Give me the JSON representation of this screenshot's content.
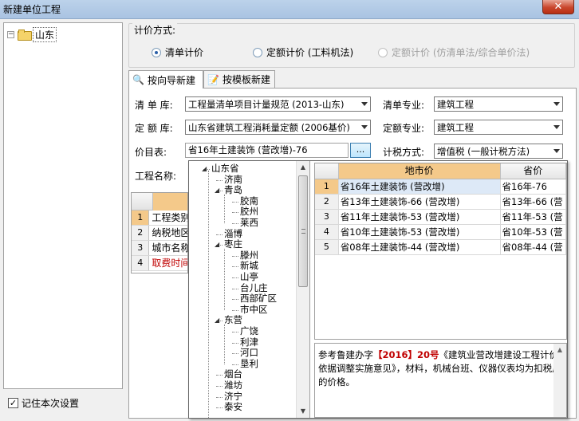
{
  "window": {
    "title": "新建单位工程",
    "close_glyph": "✕"
  },
  "region_tree": {
    "root": "山东",
    "expander": "−"
  },
  "pricing": {
    "legend": "计价方式:",
    "options": [
      {
        "label": "清单计价",
        "selected": true,
        "enabled": true
      },
      {
        "label": "定额计价 (工料机法)",
        "selected": false,
        "enabled": true
      },
      {
        "label": "定额计价 (仿清单法/综合单价法)",
        "selected": false,
        "enabled": false
      }
    ]
  },
  "tabs": [
    {
      "label": "按向导新建",
      "icon": "magnifier-icon",
      "active": true
    },
    {
      "label": "按模板新建",
      "icon": "template-icon",
      "active": false
    }
  ],
  "form": {
    "list_lib_label": "清 单 库:",
    "list_lib_value": "工程量清单项目计量规范 (2013-山东)",
    "list_spec_label": "清单专业:",
    "list_spec_value": "建筑工程",
    "quota_lib_label": "定 额 库:",
    "quota_lib_value": "山东省建筑工程消耗量定额 (2006基价)",
    "quota_spec_label": "定额专业:",
    "quota_spec_value": "建筑工程",
    "price_table_label": "价目表:",
    "price_table_value": "省16年土建装饰 (营改增)-76",
    "browse_label": "...",
    "tax_label": "计税方式:",
    "tax_value": "增值税 (一般计税方法)",
    "project_name_label": "工程名称:"
  },
  "left_grid": {
    "rows": [
      {
        "num": "1",
        "text": "工程类别",
        "selected": true,
        "red": false
      },
      {
        "num": "2",
        "text": "纳税地区",
        "selected": false,
        "red": false
      },
      {
        "num": "3",
        "text": "城市名称",
        "selected": false,
        "red": false
      },
      {
        "num": "4",
        "text": "取费时间",
        "selected": false,
        "red": true
      }
    ]
  },
  "dropdown_tree": {
    "items": [
      {
        "label": "山东省",
        "level": 0,
        "expanded": true
      },
      {
        "label": "济南",
        "level": 1
      },
      {
        "label": "青岛",
        "level": 1,
        "expanded": true
      },
      {
        "label": "胶南",
        "level": 2
      },
      {
        "label": "胶州",
        "level": 2
      },
      {
        "label": "莱西",
        "level": 2
      },
      {
        "label": "淄博",
        "level": 1
      },
      {
        "label": "枣庄",
        "level": 1,
        "expanded": true
      },
      {
        "label": "滕州",
        "level": 2
      },
      {
        "label": "新城",
        "level": 2
      },
      {
        "label": "山亭",
        "level": 2
      },
      {
        "label": "台儿庄",
        "level": 2
      },
      {
        "label": "西部矿区",
        "level": 2
      },
      {
        "label": "市中区",
        "level": 2
      },
      {
        "label": "东营",
        "level": 1,
        "expanded": true
      },
      {
        "label": "广饶",
        "level": 2
      },
      {
        "label": "利津",
        "level": 2
      },
      {
        "label": "河口",
        "level": 2
      },
      {
        "label": "垦利",
        "level": 2
      },
      {
        "label": "烟台",
        "level": 1
      },
      {
        "label": "潍坊",
        "level": 1
      },
      {
        "label": "济宁",
        "level": 1
      },
      {
        "label": "泰安",
        "level": 1
      }
    ]
  },
  "price_grid": {
    "headers": {
      "num": "",
      "city": "地市价",
      "province": "省价"
    },
    "rows": [
      {
        "num": "1",
        "city": "省16年土建装饰 (营改增)",
        "province": "省16年-76",
        "selected": true
      },
      {
        "num": "2",
        "city": "省13年土建装饰-66 (营改增)",
        "province": "省13年-66 (营",
        "selected": false
      },
      {
        "num": "3",
        "city": "省11年土建装饰-53 (营改增)",
        "province": "省11年-53 (营",
        "selected": false
      },
      {
        "num": "4",
        "city": "省10年土建装饰-53 (营改增)",
        "province": "省10年-53 (营",
        "selected": false
      },
      {
        "num": "5",
        "city": "省08年土建装饰-44 (营改增)",
        "province": "省08年-44 (营",
        "selected": false
      }
    ]
  },
  "note": {
    "pre": "参考鲁建办字",
    "hl1": "【2016】20号",
    "post": "《建筑业营改增建设工程计价依据调整实施意见》，材料，机械台班、仪器仪表均为扣税后的价格。"
  },
  "remember": {
    "label": "记住本次设置",
    "checked": true,
    "check_glyph": "✓"
  },
  "colors": {
    "header_highlight": "#f4c98a",
    "selection": "#dde9f7",
    "red_text": "#c00000"
  }
}
